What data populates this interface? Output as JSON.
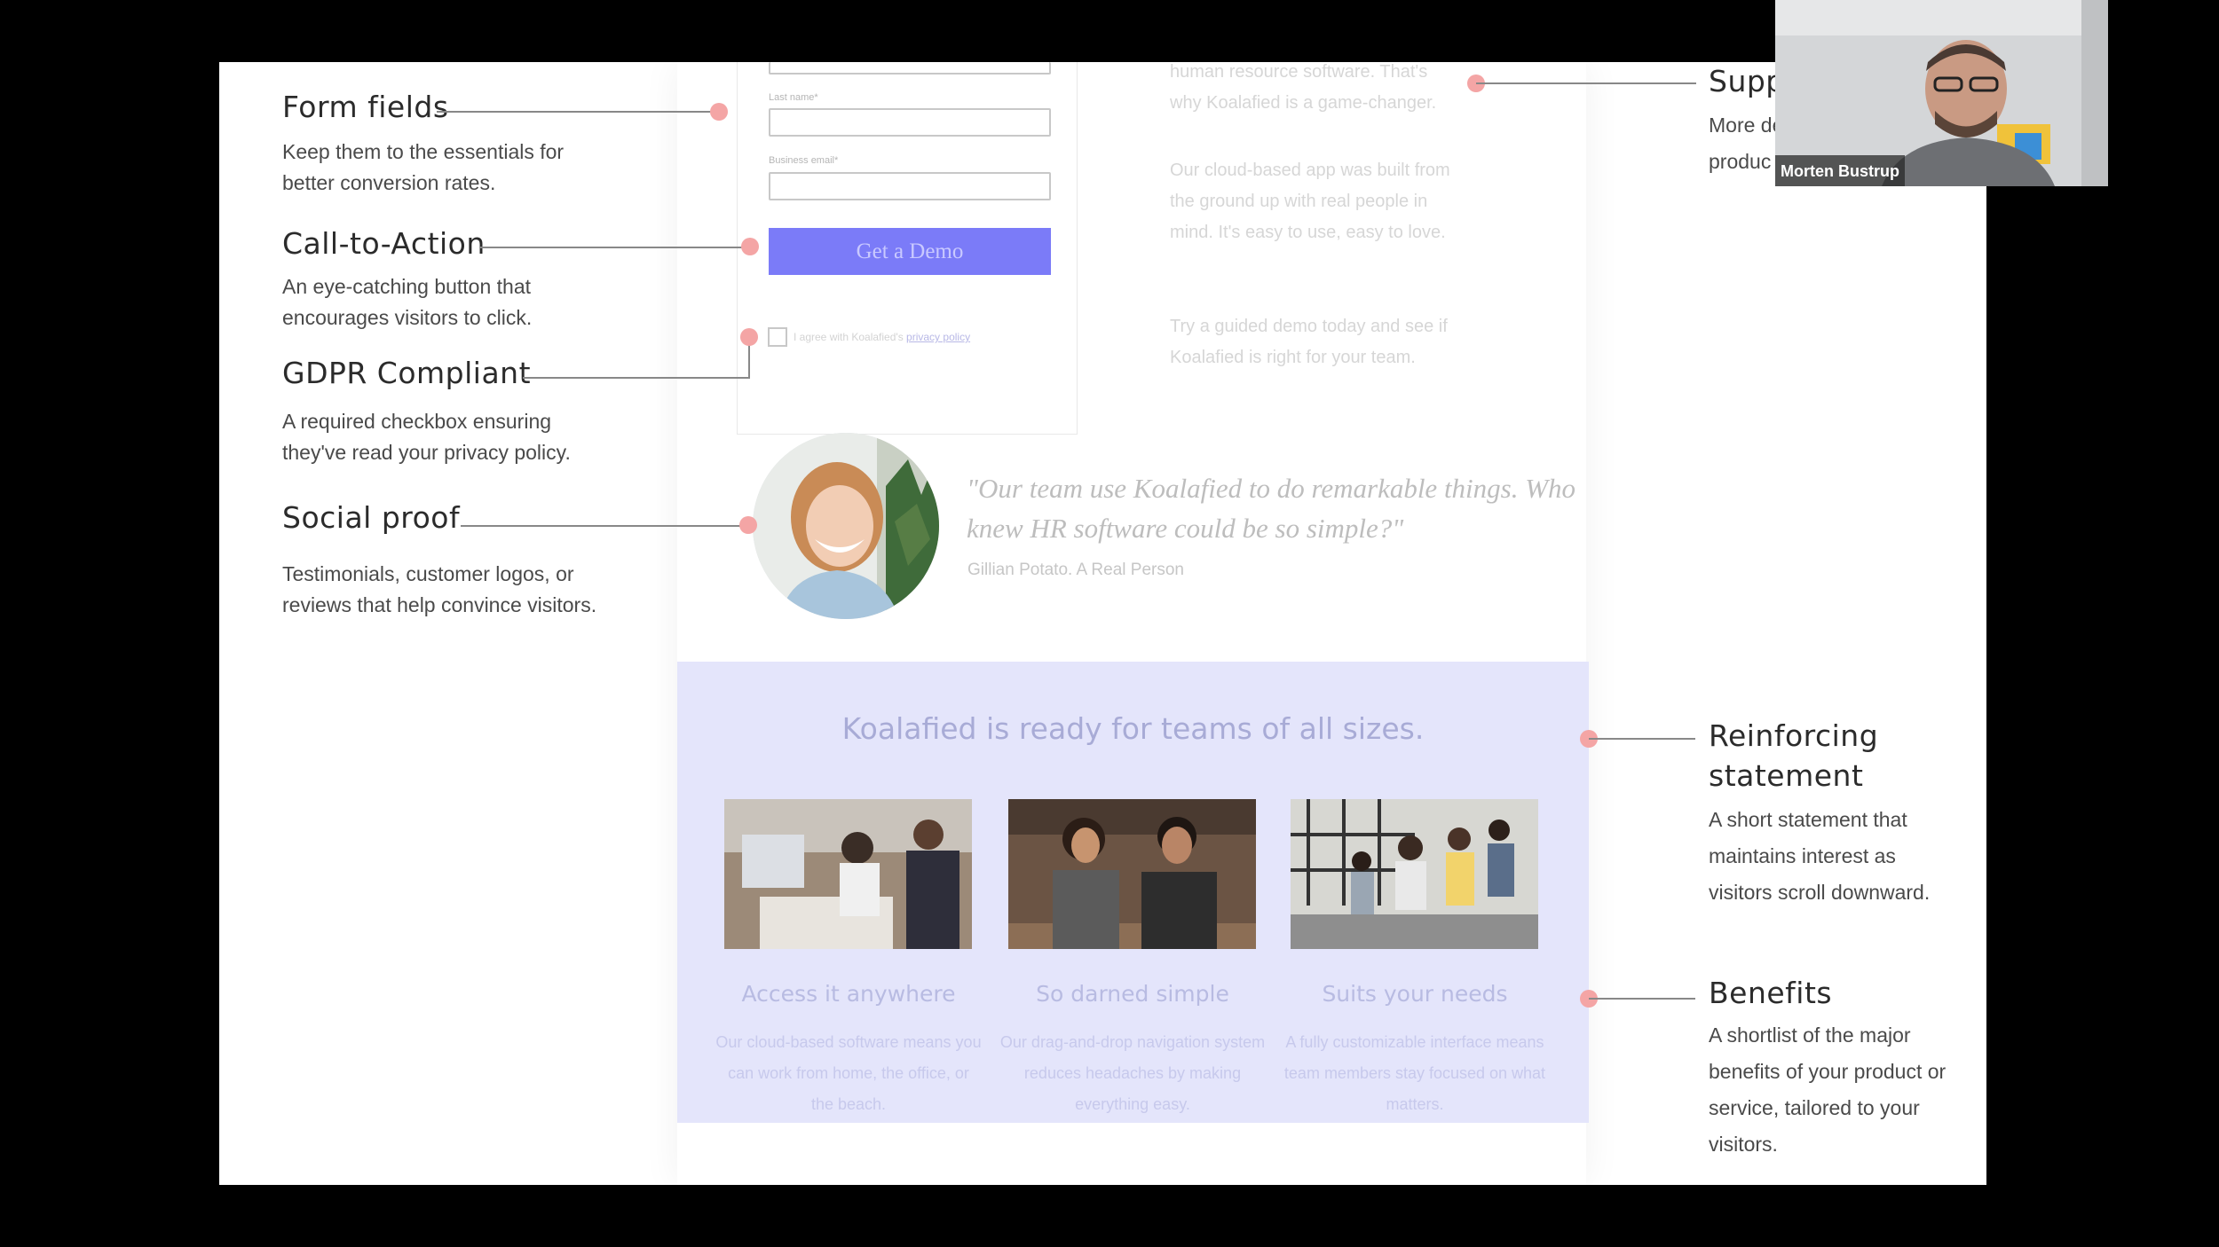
{
  "annotations_left": [
    {
      "title": "Form fields",
      "desc": "Keep them to the essentials for better conversion rates."
    },
    {
      "title": "Call-to-Action",
      "desc": "An eye-catching button that encourages visitors to click."
    },
    {
      "title": "GDPR Compliant",
      "desc": "A required checkbox ensuring they've read your privacy policy."
    },
    {
      "title": "Social proof",
      "desc": "Testimonials, customer logos, or reviews that help convince visitors."
    }
  ],
  "annotations_right": [
    {
      "title": "Supp",
      "desc1": "More de",
      "desc2": "produc"
    },
    {
      "title": "Reinforcing statement",
      "desc": "A short statement that maintains interest as visitors scroll downward."
    },
    {
      "title": "Benefits",
      "desc": "A shortlist of the major benefits of your product or service, tailored to your visitors."
    }
  ],
  "form": {
    "last_name_label": "Last name*",
    "email_label": "Business email*",
    "cta_label": "Get a Demo",
    "consent_text": "I agree with Koalafied's",
    "consent_link": "privacy policy"
  },
  "copy": {
    "p1_line1": "human resource software. That's",
    "p1_line2": "why Koalafied is a game-changer.",
    "p2": "Our cloud-based app was built from the ground up with real people in mind. It's easy to use, easy to love.",
    "p3": "Try a guided demo today and see if Koalafied is right for your team."
  },
  "testimonial": {
    "quote": "\"Our team use Koalafied to do remarkable things. Who knew HR software could be so simple?\"",
    "author": "Gillian Potato. A Real Person"
  },
  "band": {
    "title": "Koalafied is ready for teams of all sizes.",
    "features": [
      {
        "title": "Access it anywhere",
        "text": "Our cloud-based software means you can work from home, the office, or the beach."
      },
      {
        "title": "So darned simple",
        "text": "Our drag-and-drop navigation system reduces headaches by making everything easy."
      },
      {
        "title": "Suits your needs",
        "text": "A fully customizable interface means team members stay focused on what matters."
      }
    ]
  },
  "webcam": {
    "name": "Morten Bustrup"
  },
  "colors": {
    "accent": "#7b7bf8",
    "dot": "#f4a5a5",
    "band": "#e4e5fb"
  }
}
